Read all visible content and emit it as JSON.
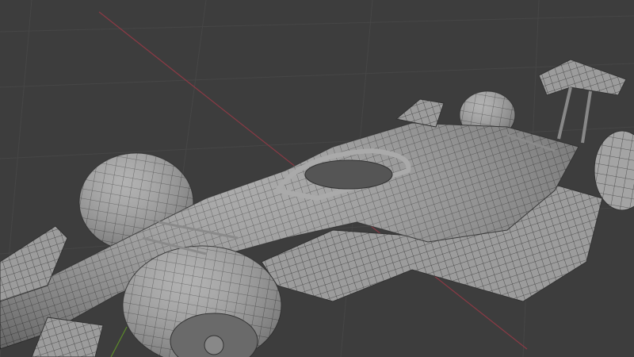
{
  "viewport": {
    "background": "#3d3d3d",
    "grid_color": "#474747",
    "x_axis_color": "#8a3a45",
    "y_axis_color": "#5c8a2a",
    "mesh_fill": "#9a9a9a",
    "mesh_wire": "#3a3a3a"
  }
}
